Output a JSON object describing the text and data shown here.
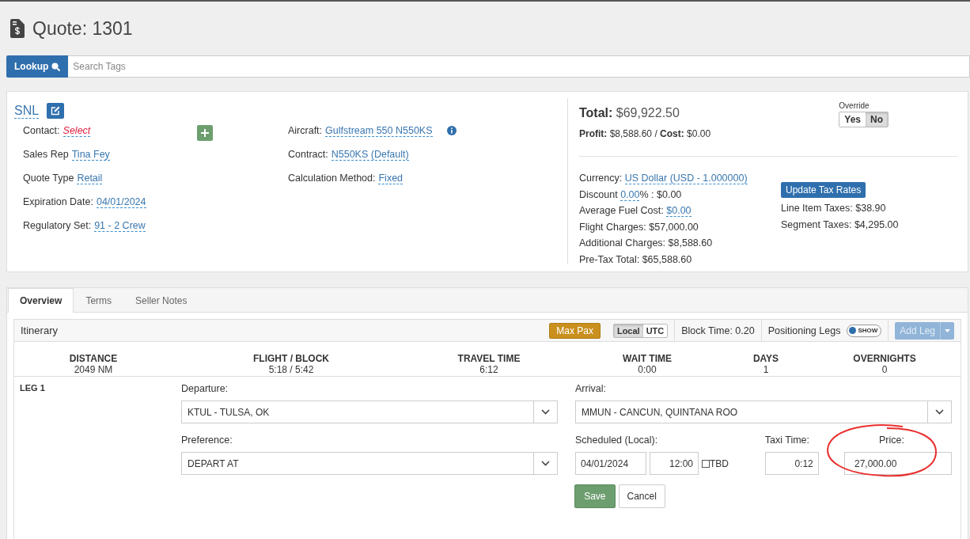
{
  "page": {
    "title": "Quote: 1301"
  },
  "search": {
    "button": "Lookup",
    "placeholder": "Search Tags"
  },
  "quote": {
    "name": "SNL",
    "left_fields": [
      {
        "label": "Contact:",
        "value": "Select",
        "kind": "missing"
      },
      {
        "label": "Sales Rep",
        "value": "Tina Fey",
        "kind": "link"
      },
      {
        "label": "Quote Type",
        "value": "Retail",
        "kind": "link"
      },
      {
        "label": "Expiration Date:",
        "value": "04/01/2024",
        "kind": "link"
      },
      {
        "label": "Regulatory Set:",
        "value": "91 - 2 Crew",
        "kind": "link"
      }
    ],
    "right_fields": [
      {
        "label": "Aircraft:",
        "value": "Gulfstream 550 N550KS",
        "kind": "link",
        "info": true
      },
      {
        "label": "Contract:",
        "value": "N550KS (Default)",
        "kind": "link",
        "info": false
      },
      {
        "label": "Calculation Method:",
        "value": "Fixed",
        "kind": "link",
        "info": false
      }
    ]
  },
  "summary": {
    "total_label": "Total:",
    "total": "$69,922.50",
    "profit": "**Profit:** $8,588.60 / **Cost:** $0.00",
    "override": {
      "label": "Override",
      "options": [
        {
          "label": "Yes",
          "selected": false
        },
        {
          "label": "No",
          "selected": true
        }
      ]
    },
    "charges": [
      {
        "label": "Currency:",
        "value": "US Dollar (USD - 1.000000)"
      },
      {
        "label": "Discount",
        "value": "0.00",
        "suffix": "% : $0.00"
      },
      {
        "label": "Average Fuel Cost:",
        "value": "$0.00"
      },
      {
        "label": "Flight Charges: $57,000.00"
      },
      {
        "label": "Additional Charges: $8,588.60"
      },
      {
        "label": "Pre-Tax Total: $65,588.60"
      }
    ],
    "tax_button": "Update Tax Rates",
    "taxes": [
      "Line Item Taxes: $38.90",
      "Segment Taxes: $4,295.00"
    ]
  },
  "tabs": [
    {
      "label": "Overview",
      "selected": true
    },
    {
      "label": "Terms",
      "selected": false
    },
    {
      "label": "Seller Notes",
      "selected": false
    }
  ],
  "itinerary": {
    "title": "Itinerary",
    "max_pax": "Max Pax",
    "time_modes": [
      {
        "label": "Local",
        "selected": true
      },
      {
        "label": "UTC",
        "selected": false
      }
    ],
    "block_time": "Block Time: 0.20",
    "positioning_label": "Positioning Legs",
    "positioning_toggle": {
      "label": "SHOW",
      "on": false
    },
    "add_leg": {
      "label": "Add Leg",
      "disabled": true
    },
    "stats": [
      {
        "label": "DISTANCE",
        "value": "2049 NM"
      },
      {
        "label": "FLIGHT / BLOCK",
        "value": "5:18 / 5:42"
      },
      {
        "label": "TRAVEL TIME",
        "value": "6:12"
      },
      {
        "label": "WAIT TIME",
        "value": "0:00"
      },
      {
        "label": "DAYS",
        "value": "1"
      },
      {
        "label": "OVERNIGHTS",
        "value": "0"
      }
    ],
    "leg": {
      "label": "LEG 1",
      "departure_label": "Departure:",
      "departure": "KTUL - TULSA, OK",
      "arrival_label": "Arrival:",
      "arrival": "MMUN - CANCUN, QUINTANA ROO",
      "preference_label": "Preference:",
      "preference": "DEPART AT",
      "scheduled_label": "Scheduled (Local):",
      "date": "04/01/2024",
      "time": "12:00",
      "tbd": {
        "label": "TBD",
        "checked": false
      },
      "taxi_label": "Taxi Time:",
      "taxi": "0:12",
      "price_label": "Price:",
      "price": "27,000.00",
      "price_circled": true,
      "save": "Save",
      "cancel": "Cancel"
    }
  }
}
